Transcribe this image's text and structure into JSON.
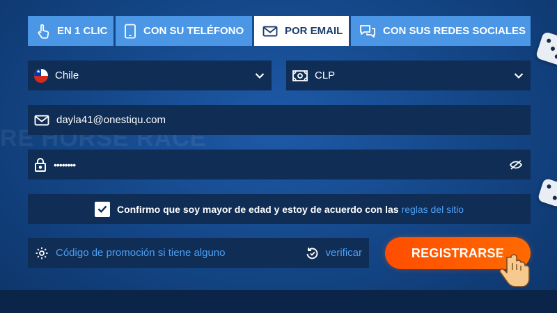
{
  "tabs": [
    {
      "label": "EN 1 CLIC",
      "icon": "hand-pointer-icon",
      "active": false
    },
    {
      "label": "CON SU TELÉFONO",
      "icon": "phone-icon",
      "active": false
    },
    {
      "label": "POR EMAIL",
      "icon": "envelope-icon",
      "active": true
    },
    {
      "label": "CON SUS REDES SOCIALES",
      "icon": "chat-bubbles-icon",
      "active": false
    }
  ],
  "country": {
    "value": "Chile",
    "icon": "chile-flag-icon"
  },
  "currency": {
    "value": "CLP",
    "icon": "banknote-icon"
  },
  "email": {
    "value": "dayla41@onestiqu.com"
  },
  "password": {
    "value": "••••••••"
  },
  "agreement": {
    "checked": true,
    "text": "Confirmo que soy mayor de edad y estoy de acuerdo con las",
    "link": "reglas del sitio"
  },
  "promo": {
    "placeholder": "Código de promoción si tiene alguno",
    "verify_label": "verificar"
  },
  "register_label": "REGISTRARSE",
  "colors": {
    "accent": "#4ea0f5",
    "button": "#ff5500",
    "field_bg": "#0f2d55",
    "tab_bg": "#4b97e6"
  }
}
